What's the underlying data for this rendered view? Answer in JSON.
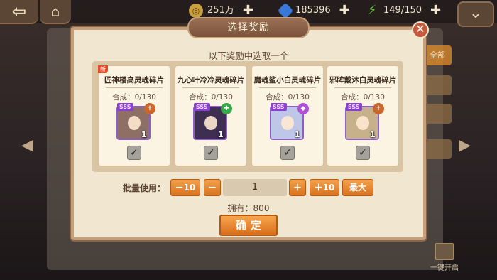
{
  "topbar": {
    "back_icon": "back-arrow-icon",
    "home_icon": "home-icon",
    "gold_amount": "251万",
    "gems_amount": "185396",
    "energy": "149/150",
    "menu_icon": "chevron-down-icon"
  },
  "background": {
    "open_all_label": "一键开启",
    "side_tabs": [
      "全部",
      "",
      "",
      ""
    ]
  },
  "dialog": {
    "title": "选择奖励",
    "subtitle": "以下奖励中选取一个",
    "new_tag": "新",
    "rarity_label": "SSS",
    "cards": [
      {
        "name": "匠神楼高灵魂碎片",
        "progress": "合成：0/130",
        "count": "1",
        "badge_color": "#c9672d",
        "portrait_color": "#8d6f66",
        "checked": true
      },
      {
        "name": "九心叶冷冷灵魂碎片",
        "progress": "合成：0/130",
        "count": "1",
        "badge_color": "#38a84a",
        "portrait_color": "#3e2f52",
        "checked": true
      },
      {
        "name": "魔魂鲨小白灵魂碎片",
        "progress": "合成：0/130",
        "count": "1",
        "badge_color": "#b04fd6",
        "portrait_color": "#bfc7e8",
        "checked": true
      },
      {
        "name": "邪眸戴沐白灵魂碎片",
        "progress": "合成：0/130",
        "count": "1",
        "badge_color": "#c9672d",
        "portrait_color": "#c6b18a",
        "checked": true
      }
    ],
    "batch_label": "批量使用：",
    "minus10": "－10",
    "minus": "－",
    "quantity": "1",
    "plus": "＋",
    "plus10": "＋10",
    "max": "最大",
    "owned": "拥有：800",
    "confirm": "确定"
  }
}
